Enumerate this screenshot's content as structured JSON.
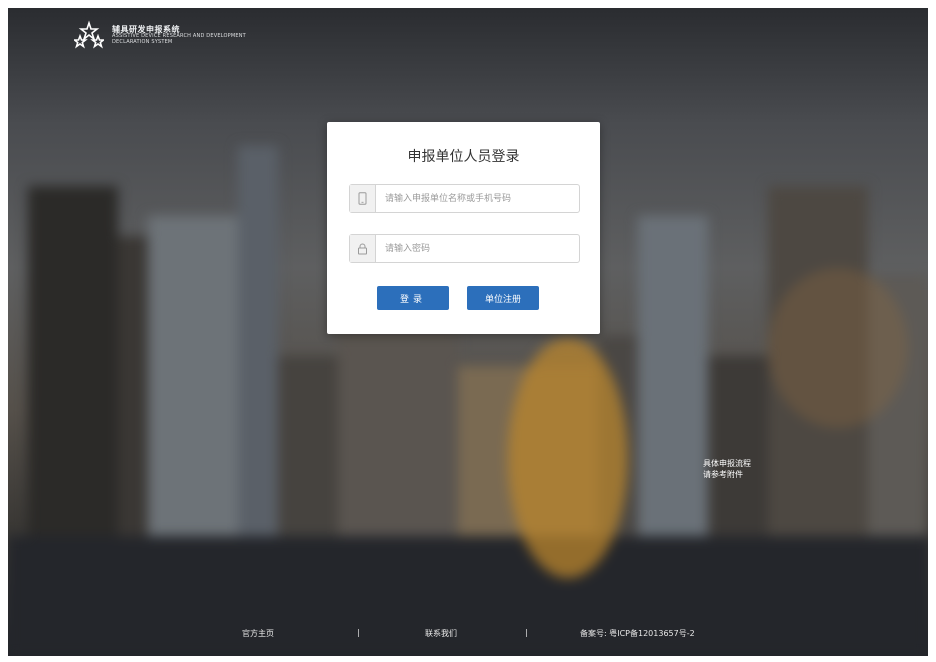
{
  "brand": {
    "title": "辅具研发申报系统",
    "subtitle_line1": "ASSISTIVE DEVICE RESEARCH AND DEVELOPMENT",
    "subtitle_line2": "DECLARATION SYSTEM",
    "icon": "star-cluster-logo"
  },
  "login": {
    "title": "申报单位人员登录",
    "username_placeholder": "请输入申报单位名称或手机号码",
    "username_icon": "phone-icon",
    "password_placeholder": "请输入密码",
    "password_icon": "lock-icon",
    "login_label": "登录",
    "register_label": "单位注册"
  },
  "note": {
    "line1": "具体申报流程",
    "line2": "请参考附件"
  },
  "footer": {
    "home": "官方主页",
    "sep1": "|",
    "contact": "联系我们",
    "sep2": "|",
    "icp": "备案号: 粤ICP备12013657号-2"
  },
  "colors": {
    "primary_button": "#2c6fbb",
    "card_bg": "#ffffff"
  }
}
